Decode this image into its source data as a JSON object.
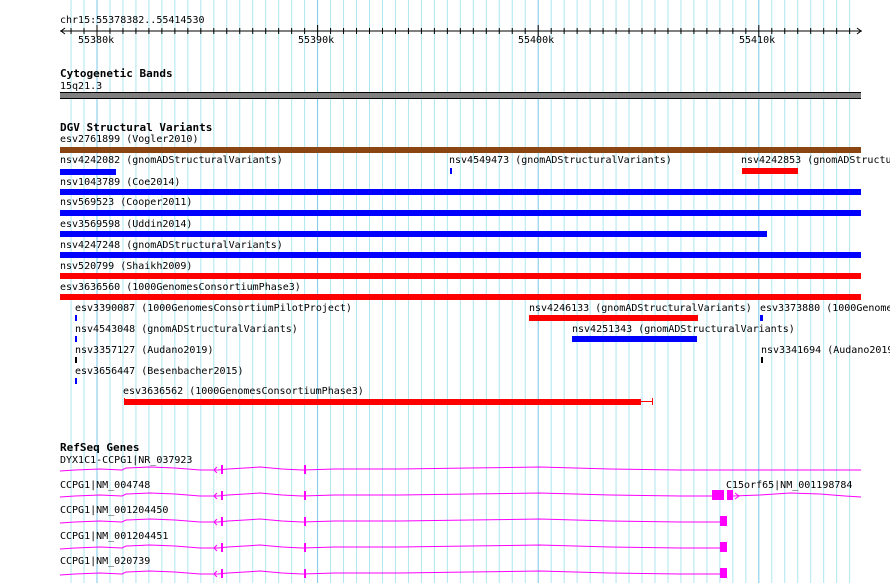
{
  "ruler": {
    "location": "chr15:55378382..55414530",
    "ticks": [
      "55380k",
      "55390k",
      "55400k",
      "55410k"
    ]
  },
  "tracks": {
    "cytobands": {
      "title": "Cytogenetic Bands",
      "band": "15q21.3"
    },
    "dgv": {
      "title": "DGV Structural Variants",
      "features": [
        "esv2761899 (Vogler2010)",
        "nsv4242082 (gnomADStructuralVariants)",
        "nsv4549473 (gnomADStructuralVariants)",
        "nsv4242853 (gnomADStructu",
        "nsv1043789 (Coe2014)",
        "nsv569523 (Cooper2011)",
        "esv3569598 (Uddin2014)",
        "nsv4247248 (gnomADStructuralVariants)",
        "nsv520799 (Shaikh2009)",
        "esv3636560 (1000GenomesConsortiumPhase3)",
        "esv3390087 (1000GenomesConsortiumPilotProject)",
        "nsv4246133 (gnomADStructuralVariants)",
        "esv3373880 (1000Genome",
        "nsv4543048 (gnomADStructuralVariants)",
        "nsv4251343 (gnomADStructuralVariants)",
        "nsv3357127 (Audano2019)",
        "nsv3341694 (Audano2019",
        "esv3656447 (Besenbacher2015)",
        "esv3636562 (1000GenomesConsortiumPhase3)"
      ]
    },
    "refseq": {
      "title": "RefSeq Genes",
      "genes": [
        "DYX1C1-CCPG1|NR_037923",
        "CCPG1|NM_004748",
        "C15orf65|NM_001198784",
        "CCPG1|NM_001204450",
        "CCPG1|NM_001204451",
        "CCPG1|NM_020739"
      ]
    }
  },
  "colors": {
    "gain": "#0000ff",
    "loss": "#ff0000",
    "complex": "#8b4513",
    "other": "#000000",
    "gene": "#ff00ff",
    "band": "#808080",
    "grid_minor": "#aee6f0",
    "grid_major": "#78c8e8"
  }
}
